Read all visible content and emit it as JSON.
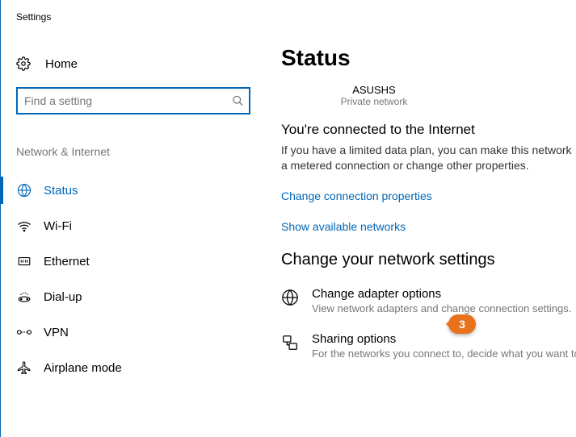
{
  "app_title": "Settings",
  "home_label": "Home",
  "search": {
    "placeholder": "Find a setting"
  },
  "sidebar": {
    "group_header": "Network & Internet",
    "items": [
      {
        "label": "Status"
      },
      {
        "label": "Wi-Fi"
      },
      {
        "label": "Ethernet"
      },
      {
        "label": "Dial-up"
      },
      {
        "label": "VPN"
      },
      {
        "label": "Airplane mode"
      }
    ]
  },
  "main": {
    "heading": "Status",
    "network_name": "ASUSHS",
    "network_type": "Private network",
    "connected_msg": "You're connected to the Internet",
    "info_text": "If you have a limited data plan, you can make this network a metered connection or change other properties.",
    "link_change_conn": "Change connection properties",
    "link_show_net": "Show available networks",
    "section_heading": "Change your network settings",
    "options": [
      {
        "title": "Change adapter options",
        "desc": "View network adapters and change connection settings."
      },
      {
        "title": "Sharing options",
        "desc": "For the networks you connect to, decide what you want to share."
      }
    ]
  },
  "callout": {
    "number": "3"
  }
}
